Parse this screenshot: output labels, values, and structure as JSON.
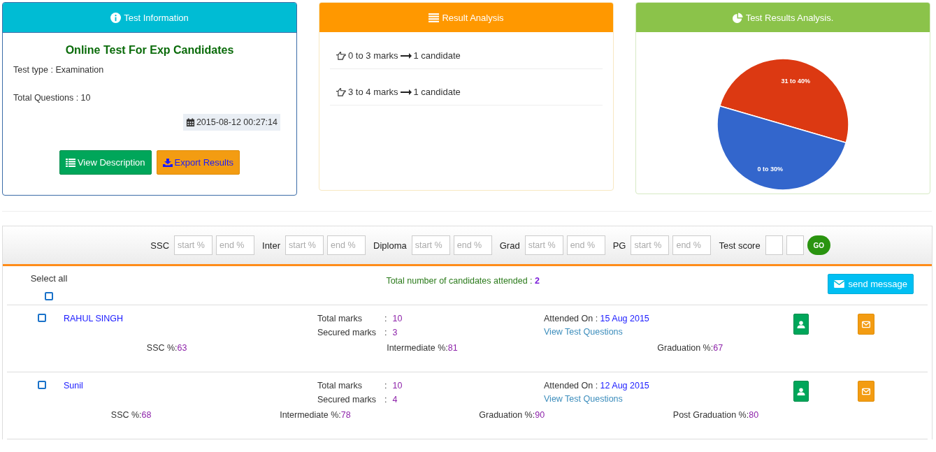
{
  "test_info": {
    "header": "Test Information",
    "title": "Online Test For Exp Candidates",
    "test_type": "Test type : Examination",
    "total_questions": "Total Questions : 10",
    "date": "2015-08-12 00:27:14",
    "buttons": [
      {
        "label": "View Description",
        "kind": "list"
      },
      {
        "label": "Export Results",
        "kind": "download"
      }
    ]
  },
  "result_analysis": {
    "header": "Result Analysis",
    "items": [
      {
        "range": "0 to 3 marks",
        "count": "1 candidate"
      },
      {
        "range": "3 to 4 marks",
        "count": "1 candidate"
      }
    ]
  },
  "results_chart": {
    "header": "Test Results Analysis.",
    "slices": [
      {
        "label": "31 to 40%",
        "color": "#dc3912"
      },
      {
        "label": "0 to 30%",
        "color": "#3366cc"
      }
    ]
  },
  "filters": {
    "groups": [
      {
        "label": "SSC",
        "start_placeholder": "start %",
        "end_placeholder": "end %"
      },
      {
        "label": "Inter",
        "start_placeholder": "start %",
        "end_placeholder": "end %"
      },
      {
        "label": "Diploma",
        "start_placeholder": "start %",
        "end_placeholder": "end %"
      },
      {
        "label": "Grad",
        "start_placeholder": "start %",
        "end_placeholder": "end %"
      },
      {
        "label": "PG",
        "start_placeholder": "start %",
        "end_placeholder": "end %"
      }
    ],
    "score_label": "Test score",
    "go": "GO"
  },
  "list": {
    "select_all": "Select all",
    "select_all_checked": false,
    "total_label": "Total number of candidates attended :",
    "total": "2",
    "send_message": "send message",
    "candidates": [
      {
        "name": "RAHUL SINGH",
        "checked": false,
        "total_marks_label": "Total marks",
        "total_marks_sep": ":",
        "total_marks": "10",
        "secured_label": "Secured marks",
        "secured_sep": ":",
        "secured": "3",
        "attended_label": "Attended On :",
        "attended_on": "15 Aug 2015",
        "link": "View Test Questions",
        "percentages": [
          {
            "label": "SSC %:",
            "value": "63"
          },
          {
            "label": "Intermediate %:",
            "value": "81"
          },
          {
            "label": "Graduation %:",
            "value": "67"
          }
        ]
      },
      {
        "name": "Sunil",
        "checked": false,
        "total_marks_label": "Total marks",
        "total_marks_sep": ":",
        "total_marks": "10",
        "secured_label": "Secured marks",
        "secured_sep": ":",
        "secured": "4",
        "attended_label": "Attended On :",
        "attended_on": "12 Aug 2015",
        "link": "View Test Questions",
        "percentages": [
          {
            "label": "SSC %:",
            "value": "68"
          },
          {
            "label": "Intermediate %:",
            "value": "78"
          },
          {
            "label": "Graduation %:",
            "value": "90"
          },
          {
            "label": "Post Graduation %:",
            "value": "80"
          }
        ]
      }
    ]
  }
}
